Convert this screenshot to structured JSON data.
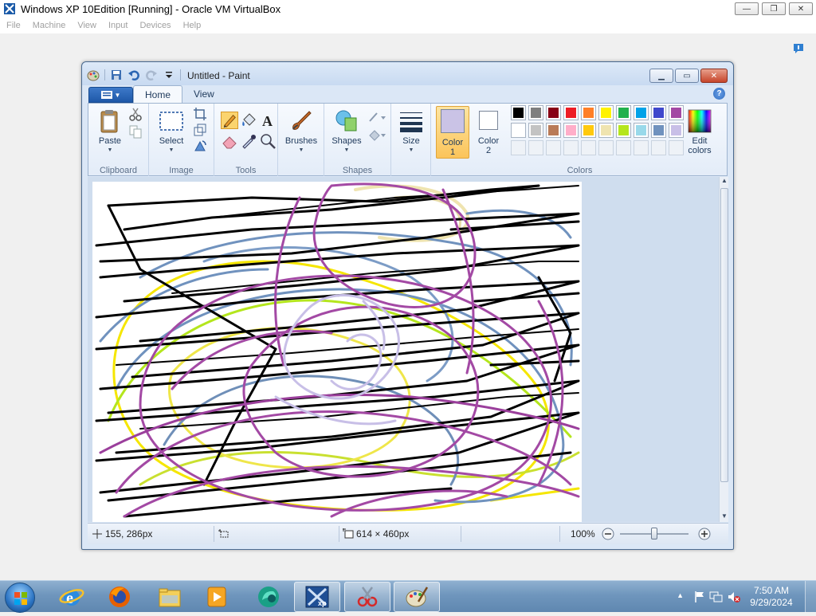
{
  "host": {
    "title": "Windows XP 10Edition [Running] - Oracle VM VirtualBox",
    "menu": [
      "File",
      "Machine",
      "View",
      "Input",
      "Devices",
      "Help"
    ]
  },
  "paint": {
    "title": "Untitled - Paint",
    "tabs": [
      "Home",
      "View"
    ],
    "active_tab": "Home",
    "groups": {
      "clipboard": {
        "label": "Clipboard",
        "paste": "Paste"
      },
      "image": {
        "label": "Image",
        "select": "Select"
      },
      "tools": {
        "label": "Tools"
      },
      "brushes": {
        "label": "Brushes"
      },
      "shapes": {
        "label": "Shapes",
        "shapes": "Shapes"
      },
      "size": {
        "label": "Size"
      },
      "colors": {
        "label": "Colors",
        "color1_line1": "Color",
        "color1_line2": "1",
        "color2_line1": "Color",
        "color2_line2": "2",
        "edit_line1": "Edit",
        "edit_line2": "colors",
        "color1_value": "#cac3e6",
        "color2_value": "#ffffff",
        "palette_row1": [
          "#000000",
          "#7f7f7f",
          "#880015",
          "#ed1c24",
          "#ff7f27",
          "#fff200",
          "#22b14c",
          "#00a2e8",
          "#3f48cc",
          "#a349a4"
        ],
        "palette_row2": [
          "#ffffff",
          "#c3c3c3",
          "#b97a57",
          "#ffaec9",
          "#ffc90e",
          "#efe4b0",
          "#b5e61d",
          "#99d9ea",
          "#7092be",
          "#c8bfe7"
        ]
      }
    },
    "status": {
      "cursor_pos": "155, 286px",
      "selection_size": "",
      "image_size": "614 × 460px",
      "zoom": "100%",
      "zoom_slider_fraction": 0.5
    }
  },
  "taskbar": {
    "time": "7:50 AM",
    "date": "9/29/2024",
    "pinned": [
      "internet-explorer",
      "firefox",
      "windows-explorer",
      "media-player",
      "edge-style-browser",
      "virtualbox",
      "snipping-tool",
      "paint"
    ]
  }
}
